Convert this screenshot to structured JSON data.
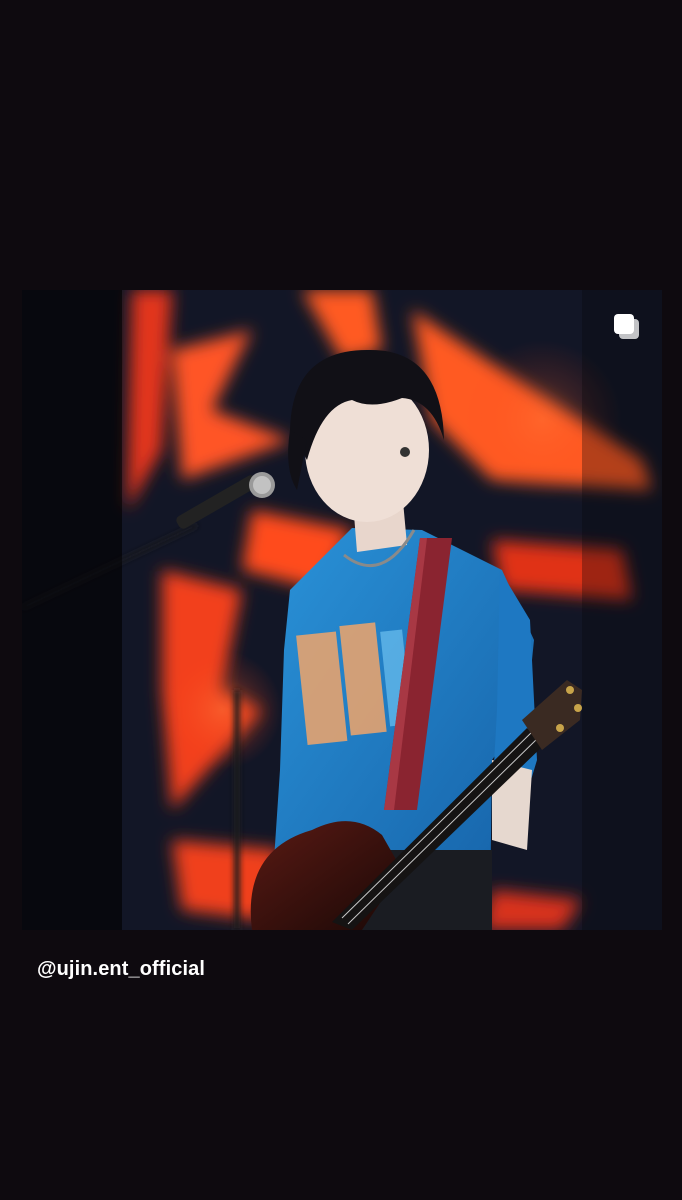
{
  "story": {
    "background_color": "#0e0a0f"
  },
  "post": {
    "image_description_icon": "multiple-photos-icon",
    "account_mention": "@ujin.ent_official"
  },
  "palette": {
    "stage_red": "#ff4a1e",
    "shirt_blue": "#1f7fc9",
    "strap": "#8a2430"
  }
}
